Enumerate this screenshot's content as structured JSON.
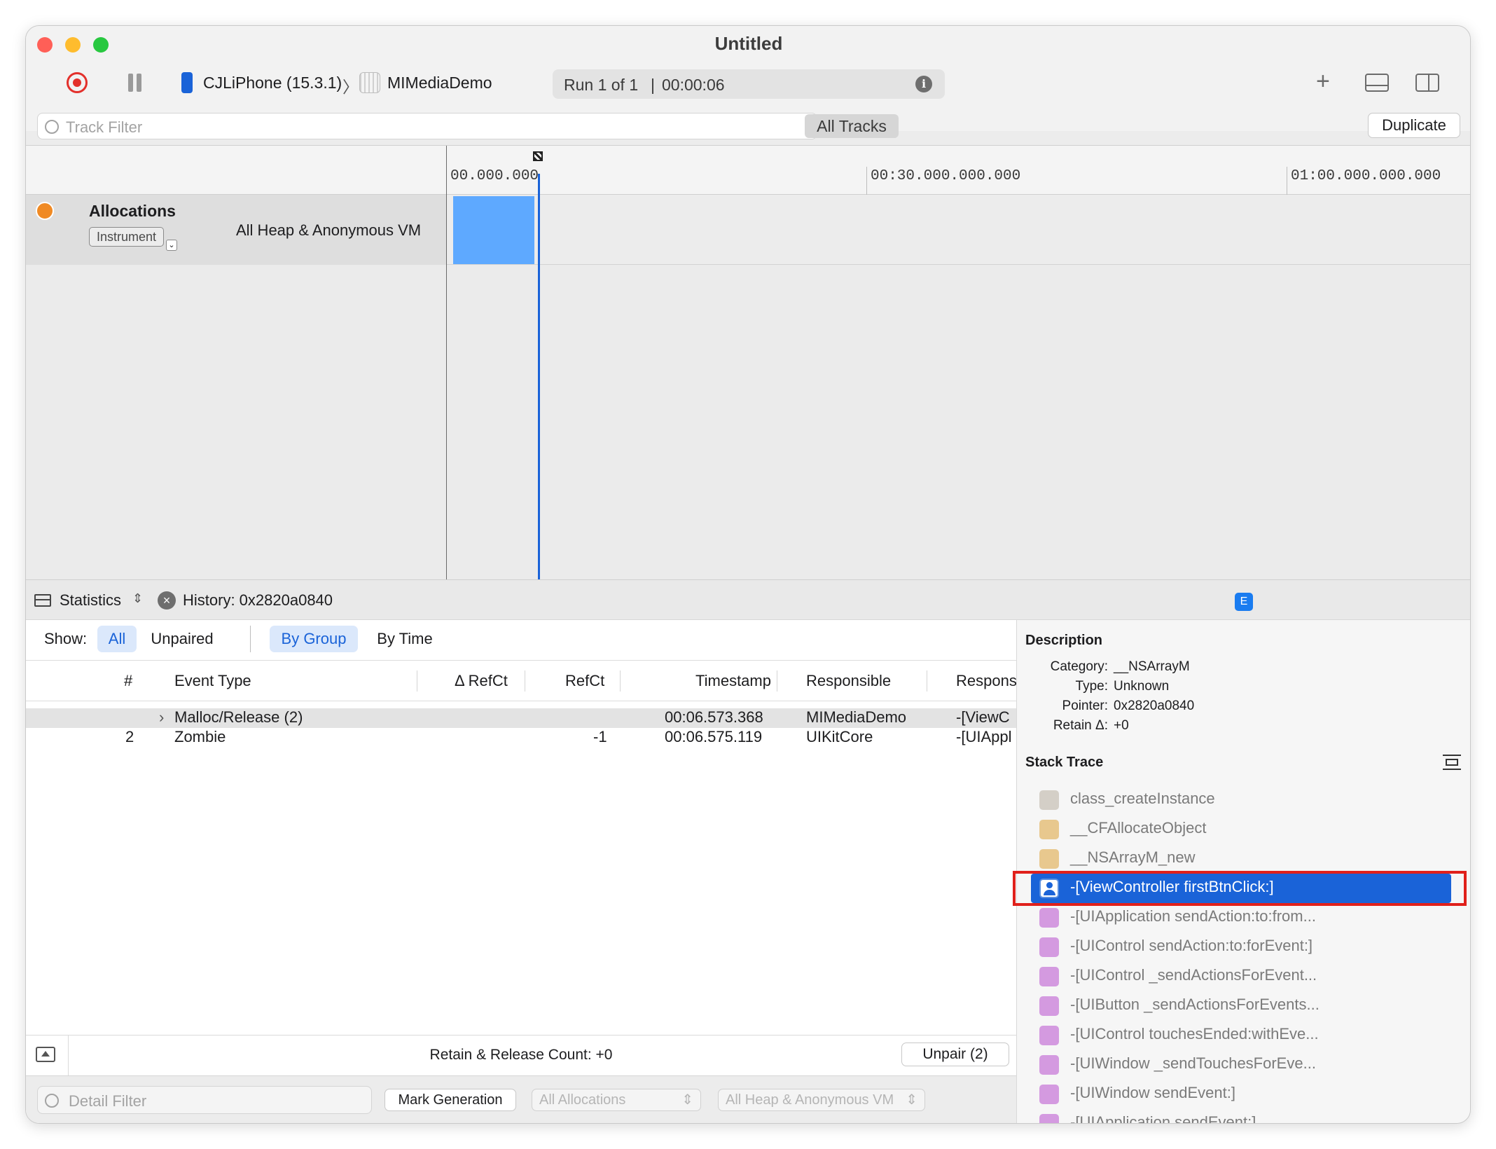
{
  "window": {
    "title": "Untitled",
    "traffic_colors": [
      "#ff5f57",
      "#febc2e",
      "#28c840"
    ]
  },
  "toolbar": {
    "device": "CJLiPhone (15.3.1)",
    "separator": "〉",
    "app": "MIMediaDemo",
    "run_label": "Run 1 of 1",
    "run_divider": "|",
    "run_time": "00:00:06"
  },
  "filterbar": {
    "track_filter_placeholder": "Track Filter",
    "all_tracks": "All Tracks",
    "duplicate": "Duplicate"
  },
  "timeline": {
    "ticks": [
      "00.000.000",
      "00:30.000.000.000",
      "01:00.000.000.000"
    ],
    "track": {
      "name": "Allocations",
      "badge": "Instrument",
      "subtitle": "All Heap & Anonymous VM"
    }
  },
  "statsbar": {
    "view_label": "Statistics",
    "history": "History: 0x2820a0840",
    "extended_badge": "E"
  },
  "show_bar": {
    "show_label": "Show:",
    "all": "All",
    "unpaired": "Unpaired",
    "by_group": "By Group",
    "by_time": "By Time"
  },
  "table": {
    "columns": [
      "#",
      "Event Type",
      "Δ RefCt",
      "RefCt",
      "Timestamp",
      "Responsible",
      "Respons"
    ],
    "rows": [
      {
        "num": "",
        "event": "Malloc/Release (2)",
        "delta": "",
        "refct": "",
        "timestamp": "00:06.573.368",
        "responsible": "MIMediaDemo",
        "caller": "-[ViewC"
      },
      {
        "num": "2",
        "event": "Zombie",
        "delta": "",
        "refct": "-1",
        "timestamp": "00:06.575.119",
        "responsible": "UIKitCore",
        "caller": "-[UIAppl"
      }
    ]
  },
  "bottom": {
    "retain_release": "Retain & Release Count: +0",
    "unpair": "Unpair (2)",
    "detail_filter_placeholder": "Detail Filter",
    "mark_generation": "Mark Generation",
    "all_allocations": "All Allocations",
    "all_heap": "All Heap & Anonymous VM"
  },
  "description": {
    "heading": "Description",
    "category_label": "Category:",
    "category_value": "__NSArrayM",
    "type_label": "Type:",
    "type_value": "Unknown",
    "pointer_label": "Pointer:",
    "pointer_value": "0x2820a0840",
    "retain_label": "Retain Δ:",
    "retain_value": "+0"
  },
  "stack_trace": {
    "heading": "Stack Trace",
    "frames": [
      {
        "label": "class_createInstance",
        "icon": "library-icon",
        "color": "#c9c2b8"
      },
      {
        "label": "__CFAllocateObject",
        "icon": "framework-icon",
        "color": "#e8c88e"
      },
      {
        "label": "__NSArrayM_new",
        "icon": "framework-icon",
        "color": "#e8c88e"
      },
      {
        "label": "-[ViewController firstBtnClick:]",
        "icon": "user-icon",
        "color": "#ffffff",
        "selected": true
      },
      {
        "label": "-[UIApplication sendAction:to:from...",
        "icon": "layers-icon",
        "color": "#c987d9"
      },
      {
        "label": "-[UIControl sendAction:to:forEvent:]",
        "icon": "layers-icon",
        "color": "#c987d9"
      },
      {
        "label": "-[UIControl _sendActionsForEvent...",
        "icon": "layers-icon",
        "color": "#c987d9"
      },
      {
        "label": "-[UIButton _sendActionsForEvents...",
        "icon": "layers-icon",
        "color": "#c987d9"
      },
      {
        "label": "-[UIControl touchesEnded:withEve...",
        "icon": "layers-icon",
        "color": "#c987d9"
      },
      {
        "label": "-[UIWindow _sendTouchesForEve...",
        "icon": "layers-icon",
        "color": "#c987d9"
      },
      {
        "label": "-[UIWindow sendEvent:]",
        "icon": "layers-icon",
        "color": "#c987d9"
      },
      {
        "label": "-[UIApplication sendEvent:]",
        "icon": "layers-icon",
        "color": "#c987d9"
      }
    ]
  },
  "colors": {
    "accent": "#1a63d8",
    "graph_fill": "#5ea9ff",
    "highlight_border": "#e0201b"
  }
}
